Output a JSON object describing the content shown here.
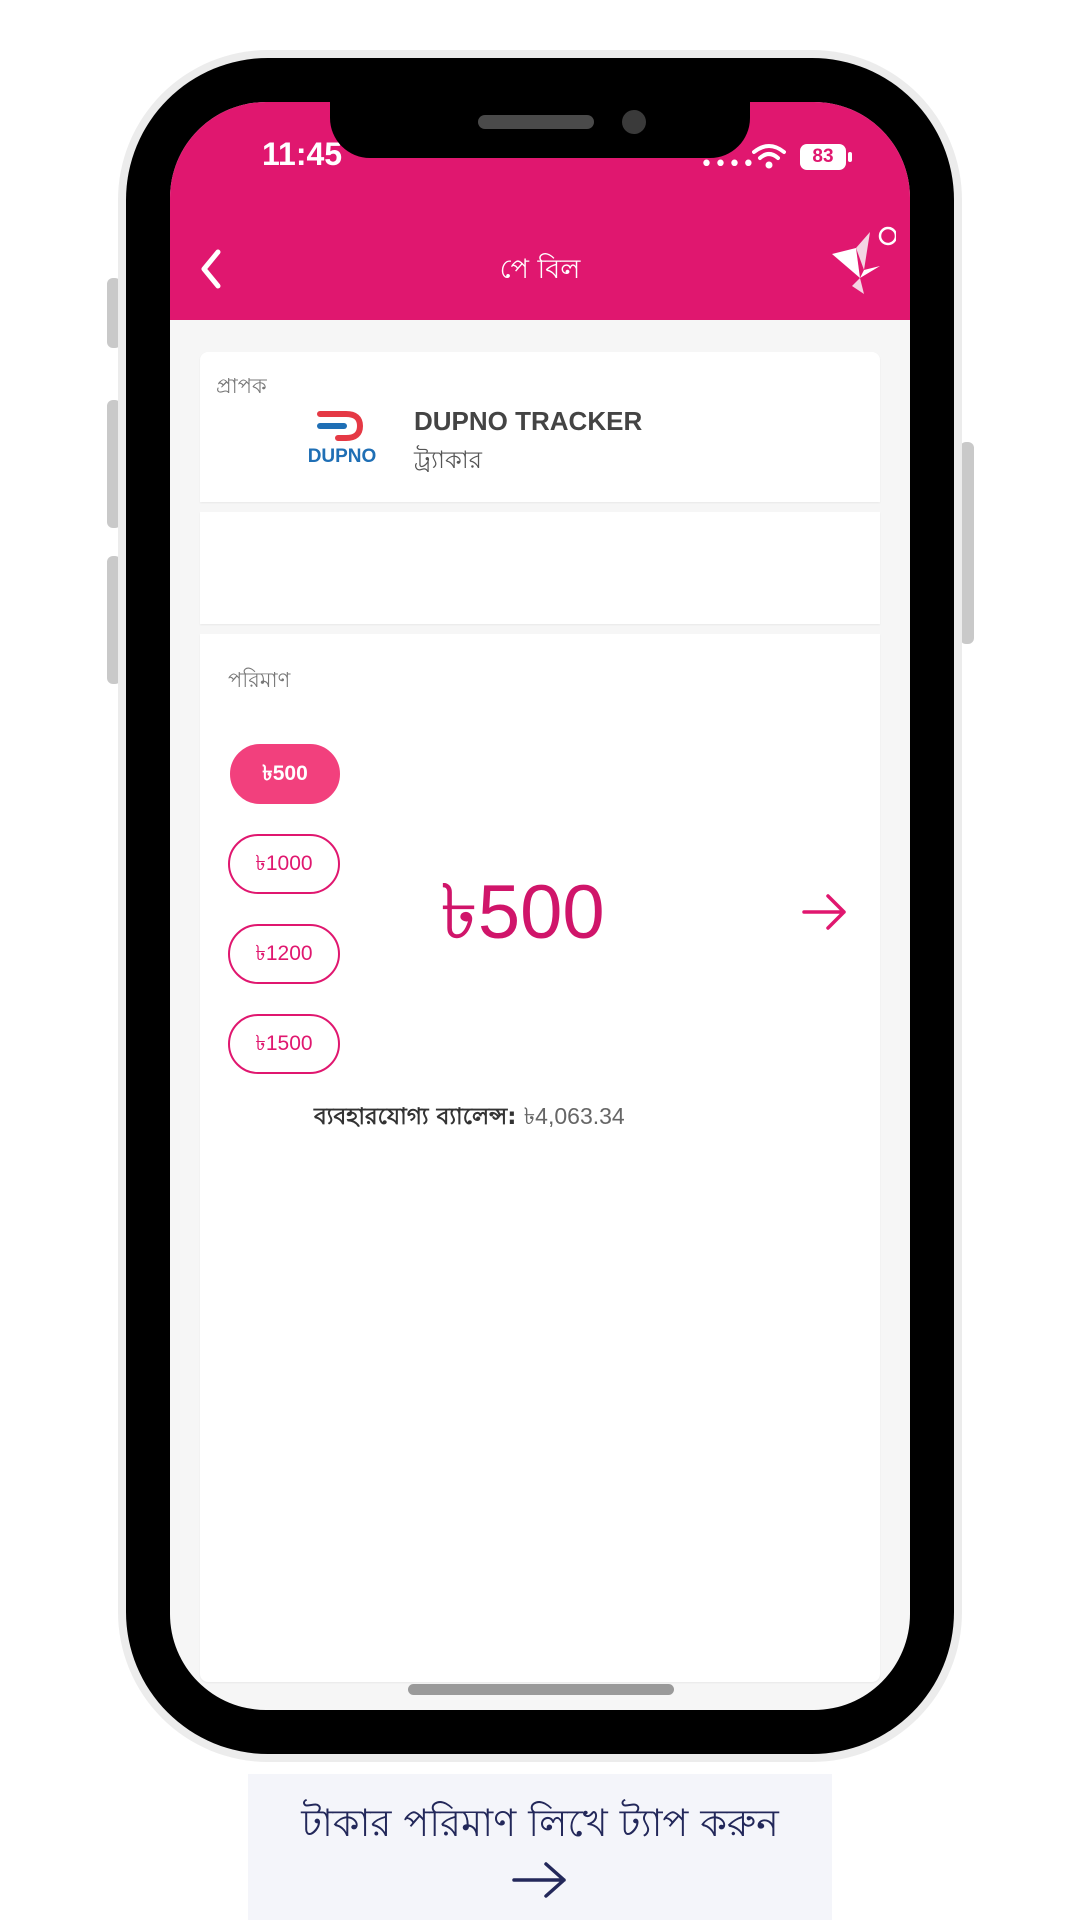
{
  "status_bar": {
    "time": "11:45",
    "battery": "83"
  },
  "appbar": {
    "title": "পে বিল",
    "back_icon": "chevron-left-icon",
    "menu_icon": "origami-bird-icon",
    "color": "#e0176f"
  },
  "recipient": {
    "label": "প্রাপক",
    "logo_text": "DUPNO",
    "name": "DUPNO TRACKER",
    "subtitle": "ট্র্যাকার"
  },
  "amount": {
    "label": "পরিমাণ",
    "presets": [
      "৳500",
      "৳1000",
      "৳1200",
      "৳1500"
    ],
    "selected_preset": "৳500",
    "current_value": "৳500",
    "next_icon": "arrow-right-icon",
    "balance_label": "ব্যবহারযোগ্য ব্যালেন্স:",
    "balance_value": "৳4,063.34"
  },
  "caption": {
    "text": "টাকার পরিমাণ লিখে ট্যাপ করুন",
    "arrow_icon": "arrow-right-icon"
  }
}
